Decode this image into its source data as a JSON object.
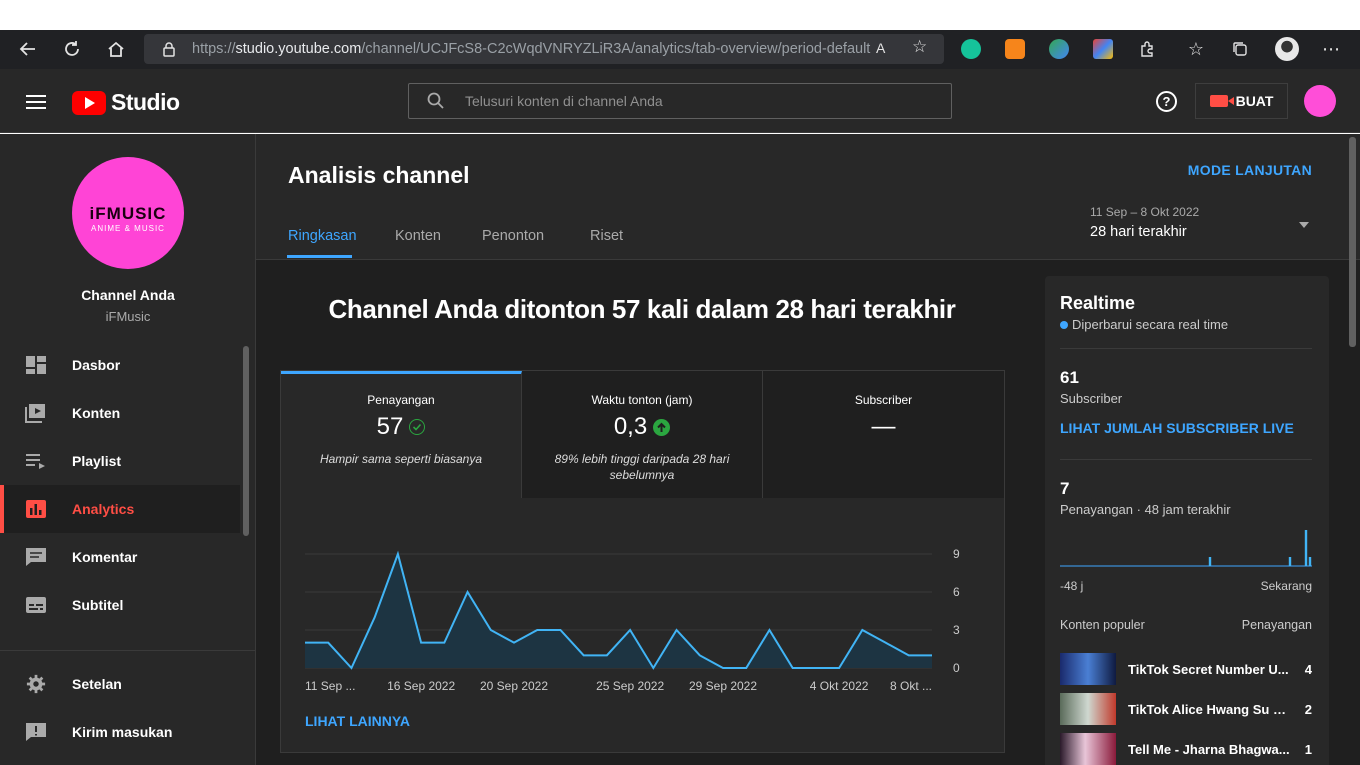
{
  "browser": {
    "url_scheme": "https://",
    "url_host": "studio.youtube.com",
    "url_path": "/channel/UCJFcS8-C2cWqdVNRYZLiR3A/analytics/tab-overview/period-default"
  },
  "header": {
    "logo_text": "Studio",
    "search_placeholder": "Telusuri konten di channel Anda",
    "create_label": "BUAT"
  },
  "sidebar": {
    "avatar_line1": "iFMUSIC",
    "avatar_line2": "ANIME & MUSIC",
    "channel_label": "Channel Anda",
    "channel_name": "iFMusic",
    "items": [
      {
        "label": "Dasbor",
        "icon": "dashboard-icon"
      },
      {
        "label": "Konten",
        "icon": "content-icon"
      },
      {
        "label": "Playlist",
        "icon": "playlist-icon"
      },
      {
        "label": "Analytics",
        "icon": "analytics-icon",
        "active": true
      },
      {
        "label": "Komentar",
        "icon": "comment-icon"
      },
      {
        "label": "Subtitel",
        "icon": "subtitle-icon"
      }
    ],
    "bottom_items": [
      {
        "label": "Setelan",
        "icon": "gear-icon"
      },
      {
        "label": "Kirim masukan",
        "icon": "feedback-icon"
      }
    ]
  },
  "main": {
    "title": "Analisis channel",
    "mode_button": "MODE LANJUTAN",
    "tabs": [
      "Ringkasan",
      "Konten",
      "Penonton",
      "Riset"
    ],
    "active_tab": "Ringkasan",
    "date_range": "11 Sep – 8 Okt 2022",
    "date_label": "28 hari terakhir",
    "headline": "Channel Anda ditonton 57 kali dalam 28 hari terakhir",
    "metrics": [
      {
        "title": "Penayangan",
        "value": "57",
        "status": "check",
        "sub": "Hampir sama seperti biasanya"
      },
      {
        "title": "Waktu tonton (jam)",
        "value": "0,3",
        "status": "up",
        "sub": "89% lebih tinggi daripada 28 hari sebelumnya"
      },
      {
        "title": "Subscriber",
        "value": "—",
        "status": "",
        "sub": ""
      }
    ],
    "see_more": "LIHAT LAINNYA"
  },
  "chart_data": {
    "type": "area",
    "x_labels": [
      "11 Sep ...",
      "16 Sep 2022",
      "20 Sep 2022",
      "25 Sep 2022",
      "29 Sep 2022",
      "4 Okt 2022",
      "8 Okt ..."
    ],
    "x_label_index": [
      0,
      5,
      9,
      14,
      18,
      23,
      27
    ],
    "y_ticks": [
      0,
      3,
      6,
      9
    ],
    "ylim": [
      0,
      9
    ],
    "values": [
      2,
      2,
      0,
      4,
      9,
      2,
      2,
      6,
      3,
      2,
      3,
      3,
      1,
      1,
      3,
      0,
      3,
      1,
      0,
      0,
      3,
      0,
      0,
      0,
      3,
      2,
      1,
      1
    ],
    "line_color": "#41b4f5",
    "grid": true
  },
  "realtime": {
    "title": "Realtime",
    "subtitle": "Diperbarui secara real time",
    "subs_value": "61",
    "subs_label": "Subscriber",
    "subs_link": "LIHAT JUMLAH SUBSCRIBER LIVE",
    "views_value": "7",
    "views_label": "Penayangan · 48 jam terakhir",
    "axis_start": "-48 j",
    "axis_end": "Sekarang",
    "spark_values": [
      0,
      0,
      0,
      0,
      0,
      0,
      0,
      0,
      0,
      0,
      0,
      0,
      0,
      0,
      0,
      0,
      0,
      0,
      0,
      0,
      0,
      0,
      0,
      0,
      0,
      0,
      0,
      0,
      0,
      0,
      0,
      0,
      0,
      0,
      0,
      0,
      0,
      1,
      0,
      0,
      0,
      0,
      0,
      0,
      0,
      0,
      0,
      0,
      0,
      0,
      0,
      0,
      0,
      0,
      0,
      0,
      0,
      1,
      0,
      0,
      0,
      4,
      1
    ],
    "spark_color": "#41b4f5",
    "popular_header": "Konten populer",
    "views_header": "Penayangan",
    "popular": [
      {
        "title": "TikTok Secret Number U...",
        "views": "4"
      },
      {
        "title": "TikTok Alice Hwang Su K...",
        "views": "2"
      },
      {
        "title": "Tell Me - Jharna Bhagwa...",
        "views": "1"
      }
    ]
  },
  "colors": {
    "accent_blue": "#3ea6ff",
    "brand_red": "#ff0000",
    "active_red": "#ff4e45",
    "avatar_pink": "#ff44d6",
    "success_green": "#2ba640"
  }
}
